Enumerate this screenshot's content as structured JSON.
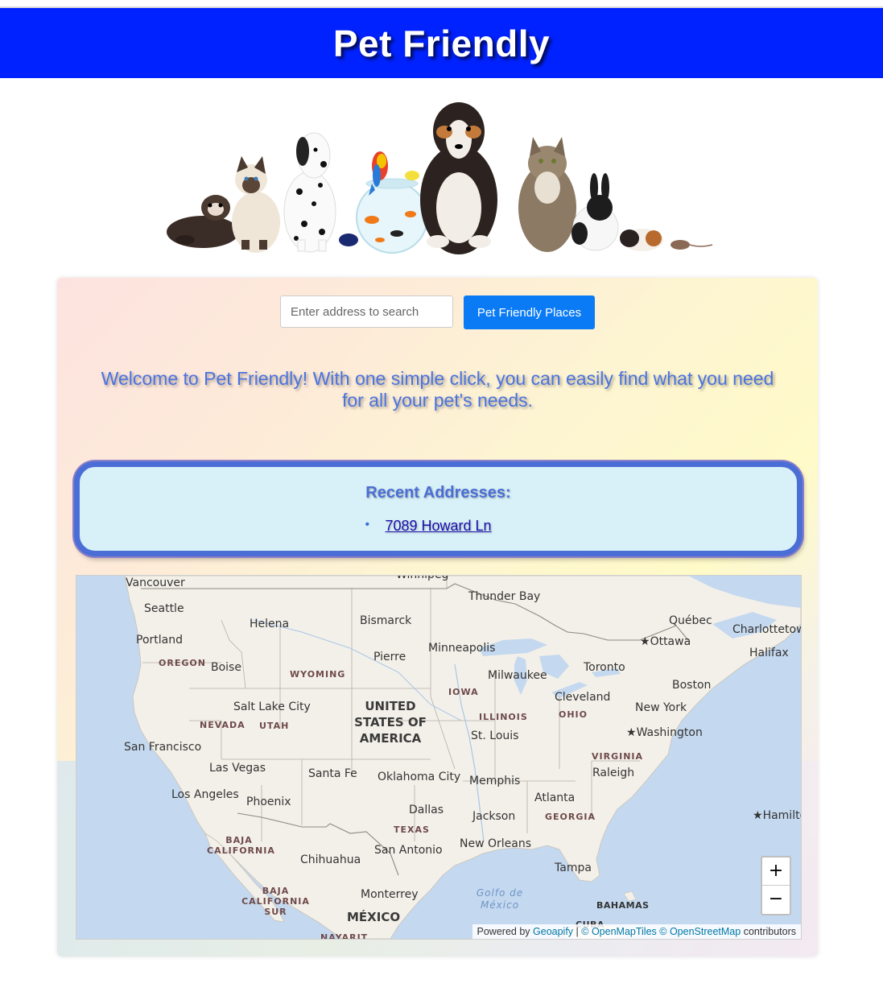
{
  "header": {
    "title": "Pet Friendly"
  },
  "search": {
    "placeholder": "Enter address to search",
    "button_label": "Pet Friendly Places"
  },
  "welcome_text": "Welcome to Pet Friendly! With one simple click, you can easily find what you need for all your pet's needs.",
  "recent": {
    "title": "Recent Addresses:",
    "items": [
      "7089 Howard Ln"
    ]
  },
  "map": {
    "cities": [
      "Vancouver",
      "Seattle",
      "Portland",
      "Helena",
      "Bismarck",
      "Boise",
      "Pierre",
      "Minneapolis",
      "Thunder Bay",
      "Québec",
      "Ottawa",
      "Charlottetown",
      "Halifax",
      "Toronto",
      "Milwaukee",
      "Boston",
      "Cleveland",
      "New York",
      "Washington",
      "Salt Lake City",
      "San Francisco",
      "Las Vegas",
      "Los Angeles",
      "Phoenix",
      "Santa Fe",
      "Oklahoma City",
      "Memphis",
      "Raleigh",
      "Atlanta",
      "Dallas",
      "Jackson",
      "San Antonio",
      "New Orleans",
      "Tampa",
      "Chihuahua",
      "Monterrey",
      "St. Louis",
      "Hamilton",
      "Winnipeg"
    ],
    "regions": [
      "OREGON",
      "WYOMING",
      "IOWA",
      "NEVADA",
      "UTAH",
      "ILLINOIS",
      "OHIO",
      "VIRGINIA",
      "GEORGIA",
      "TEXAS",
      "BAJA CALIFORNIA",
      "BAJA CALIFORNIA SUR",
      "NAYARIT",
      "BAHAMAS",
      "CUBA"
    ],
    "countries": [
      "UNITED STATES OF AMERICA",
      "MÉXICO"
    ],
    "water": [
      "Golfo de México"
    ],
    "zoom_in": "+",
    "zoom_out": "−",
    "attribution": {
      "prefix": "Powered by",
      "geoapify": "Geoapify",
      "sep": "|",
      "omt": "© OpenMapTiles",
      "osm": "© OpenStreetMap",
      "suffix": "contributors"
    }
  }
}
